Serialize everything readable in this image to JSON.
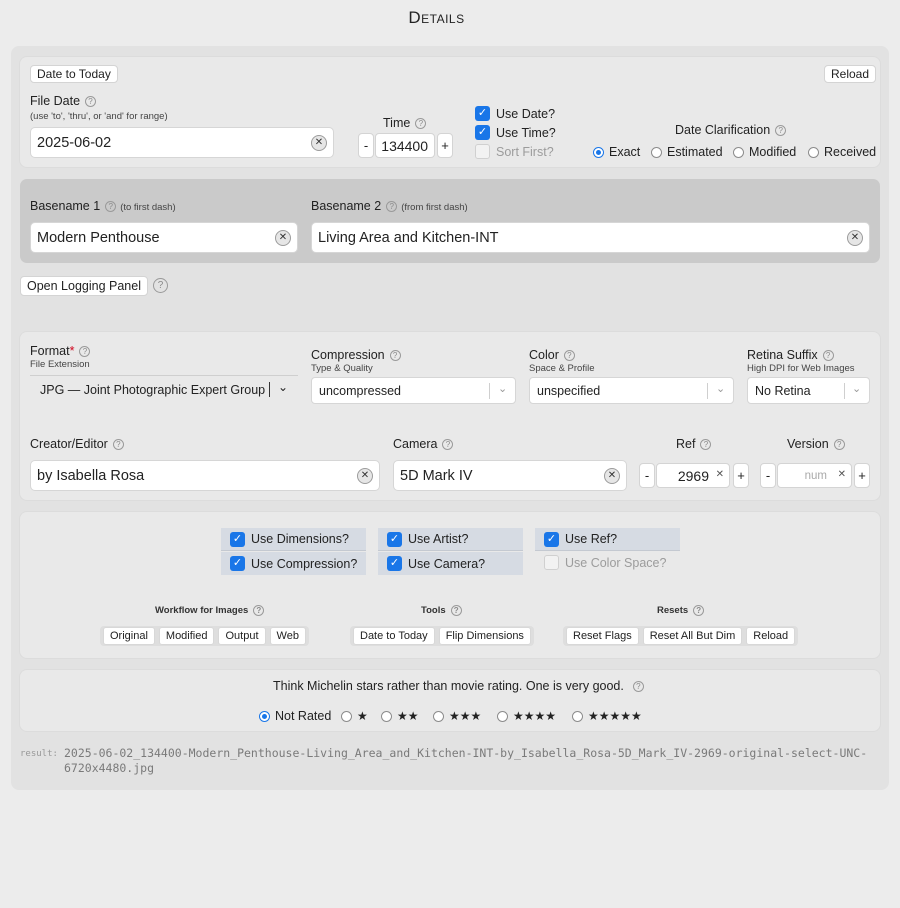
{
  "page_title": "Details",
  "date_section": {
    "date_to_today": "Date to Today",
    "reload": "Reload",
    "file_date_label": "File Date",
    "file_date_hint": "(use 'to', 'thru', or 'and' for range)",
    "file_date_value": "2025-06-02",
    "time_label": "Time",
    "time_value": "134400",
    "minus": "-",
    "plus": "+",
    "use_date": "Use Date?",
    "use_time": "Use Time?",
    "sort_first": "Sort First?",
    "date_clarification_label": "Date Clarification",
    "clarification_options": [
      "Exact",
      "Estimated",
      "Modified",
      "Received"
    ],
    "clarification_selected": "Exact"
  },
  "basename": {
    "b1_label": "Basename 1",
    "b1_hint": "(to first dash)",
    "b1_value": "Modern Penthouse",
    "b2_label": "Basename 2",
    "b2_hint": "(from first dash)",
    "b2_value": "Living Area and Kitchen-INT"
  },
  "open_logging": "Open Logging Panel",
  "format_section": {
    "format_label": "Format",
    "required_mark": "*",
    "format_sub": "File Extension",
    "format_value": "JPG — Joint Photographic Expert Group",
    "compression_label": "Compression",
    "compression_sub": "Type & Quality",
    "compression_value": "uncompressed",
    "color_label": "Color",
    "color_sub": "Space & Profile",
    "color_value": "unspecified",
    "retina_label": "Retina Suffix",
    "retina_sub": "High DPI for Web Images",
    "retina_value": "No Retina",
    "creator_label": "Creator/Editor",
    "creator_value": "by Isabella Rosa",
    "camera_label": "Camera",
    "camera_value": "5D Mark IV",
    "ref_label": "Ref",
    "ref_value": "2969",
    "version_label": "Version",
    "version_placeholder": "num"
  },
  "toggles": {
    "use_dimensions": "Use Dimensions?",
    "use_compression": "Use Compression?",
    "use_artist": "Use Artist?",
    "use_camera": "Use Camera?",
    "use_ref": "Use Ref?",
    "use_color_space": "Use Color Space?"
  },
  "workflow": {
    "title": "Workflow for Images",
    "buttons": [
      "Original",
      "Modified",
      "Output",
      "Web"
    ]
  },
  "tools": {
    "title": "Tools",
    "buttons": [
      "Date to Today",
      "Flip Dimensions"
    ]
  },
  "resets": {
    "title": "Resets",
    "buttons": [
      "Reset Flags",
      "Reset All But Dim",
      "Reload"
    ]
  },
  "rating": {
    "hint": "Think Michelin stars rather than movie rating. One is very good.",
    "options": [
      "Not Rated",
      "★",
      "★★",
      "★★★",
      "★★★★",
      "★★★★★"
    ],
    "selected": "Not Rated"
  },
  "result_label": "result:",
  "result_value": "2025-06-02_134400-Modern_Penthouse-Living_Area_and_Kitchen-INT-by_Isabella_Rosa-5D_Mark_IV-2969-original-select-UNC-6720x4480.jpg",
  "colors": {
    "accent": "#1976e8",
    "required": "#d0021b"
  }
}
